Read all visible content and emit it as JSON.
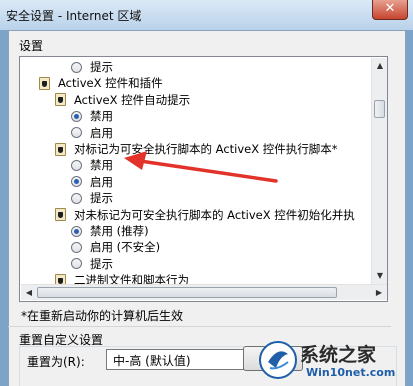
{
  "window": {
    "title": "安全设置 - Internet 区域",
    "close_glyph": "✕"
  },
  "settings": {
    "group_label": "设置",
    "items": [
      {
        "kind": "radio",
        "label": "提示",
        "checked": false
      },
      {
        "kind": "group",
        "icon": "settings-group-icon",
        "label": "ActiveX 控件和插件"
      },
      {
        "kind": "subgroup",
        "icon": "settings-group-icon",
        "label": "ActiveX 控件自动提示"
      },
      {
        "kind": "radio",
        "label": "禁用",
        "checked": true
      },
      {
        "kind": "radio",
        "label": "启用",
        "checked": false
      },
      {
        "kind": "subgroup",
        "icon": "settings-group-icon",
        "label": "对标记为可安全执行脚本的 ActiveX 控件执行脚本*"
      },
      {
        "kind": "radio",
        "label": "禁用",
        "checked": false
      },
      {
        "kind": "radio",
        "label": "启用",
        "checked": true
      },
      {
        "kind": "radio",
        "label": "提示",
        "checked": false
      },
      {
        "kind": "subgroup",
        "icon": "settings-group-icon",
        "label": "对未标记为可安全执行脚本的 ActiveX 控件初始化并执"
      },
      {
        "kind": "radio",
        "label": "禁用 (推荐)",
        "checked": true
      },
      {
        "kind": "radio",
        "label": "启用 (不安全)",
        "checked": false
      },
      {
        "kind": "radio",
        "label": "提示",
        "checked": false
      },
      {
        "kind": "subgroup",
        "icon": "settings-group-icon",
        "label": "二进制文件和脚本行为"
      }
    ]
  },
  "note": "*在重新启动你的计算机后生效",
  "reset": {
    "title": "重置自定义设置",
    "label": "重置为(R):",
    "selected": "中-高 (默认值)"
  },
  "scroll": {
    "position": 0.2
  },
  "watermark": {
    "text1": "系统之家",
    "text2": "Win10net.com"
  },
  "colors": {
    "annotation_arrow": "#e2322a",
    "radio_dot": "#2a5fb0"
  }
}
